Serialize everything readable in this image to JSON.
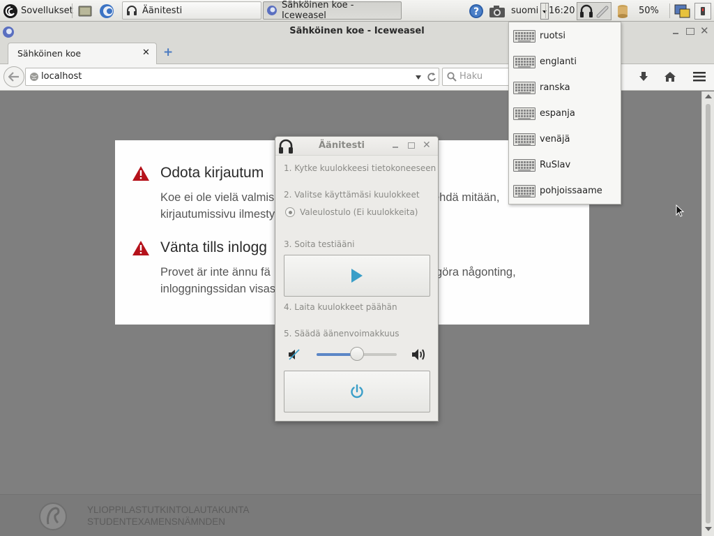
{
  "panel": {
    "apps_label": "Sovellukset",
    "tasks": [
      {
        "label": "Äänitesti",
        "active": false
      },
      {
        "label": "Sähköinen koe - Iceweasel",
        "active": true
      }
    ],
    "keyboard_layout": "suomi",
    "clock": "16:20",
    "battery": "50%"
  },
  "browser": {
    "window_title": "Sähköinen koe - Iceweasel",
    "tab_title": "Sähköinen koe",
    "url": "localhost",
    "search_placeholder": "Haku"
  },
  "page": {
    "notices": [
      {
        "title": "Odota kirjautum",
        "body_line1": "Koe ei ole vielä valmis",
        "body_line1_end": "ehdä mitään,",
        "body_line2": "kirjautumissivu ilmesty"
      },
      {
        "title": "Vänta tills inlogg",
        "body_line1": "Provet är inte ännu fä",
        "body_line1_end": "göra någonting,",
        "body_line2": "inloggningssidan visas"
      }
    ],
    "footer_line1": "YLIOPPILASTUTKINTOLAUTAKUNTA",
    "footer_line2": "STUDENTEXAMENSNÄMNDEN"
  },
  "dialog": {
    "title": "Äänitesti",
    "step1": "1. Kytke kuulokkeesi tietokoneeseen",
    "step2": "2. Valitse käyttämäsi kuulokkeet",
    "device_option": "Valeulostulo (Ei kuulokkeita)",
    "step3": "3. Soita testiääni",
    "step4": "4. Laita kuulokkeet päähän",
    "step5": "5. Säädä äänenvoimakkuus",
    "volume_level": 0.5
  },
  "keyboard_menu": {
    "items": [
      "ruotsi",
      "englanti",
      "ranska",
      "espanja",
      "venäjä",
      "RuSlav",
      "pohjoissaame"
    ]
  },
  "colors": {
    "accent": "#3a9ec8",
    "warning": "#b5121b",
    "slider": "#5b86c6"
  }
}
